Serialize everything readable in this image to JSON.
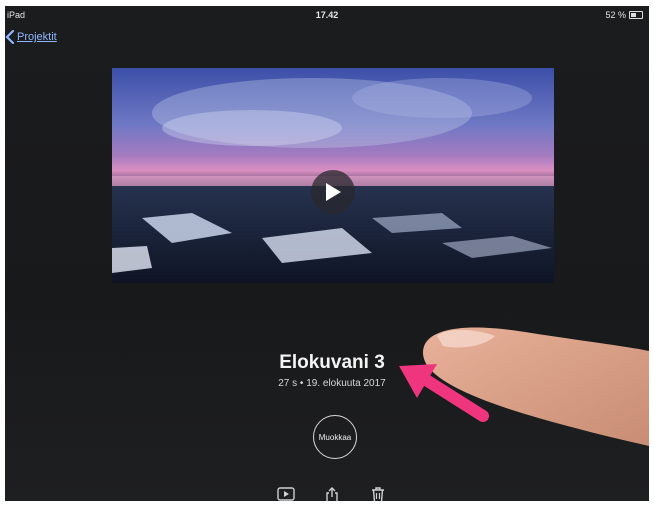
{
  "statusbar": {
    "left": "iPad",
    "time": "17.42",
    "battery": "52 %"
  },
  "nav": {
    "back_label": "Projektit"
  },
  "project": {
    "title": "Elokuvani 3",
    "meta": "27 s • 19. elokuuta 2017"
  },
  "actions": {
    "edit_label": "Muokkaa"
  },
  "toolbar": {
    "icons": [
      "play-icon",
      "share-icon",
      "trash-icon"
    ]
  },
  "colors": {
    "accent_link": "#8fb7ff",
    "annotation_arrow": "#f0357f"
  }
}
